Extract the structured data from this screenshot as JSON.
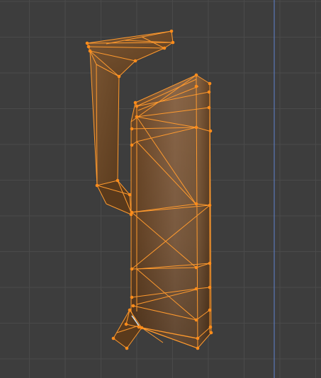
{
  "viewport": {
    "background_color": "#3d3d3d",
    "grid_color": "#4a4a4a",
    "z_axis_color": "#5a78b8",
    "mode": "edit-mode",
    "selection_state": "all-selected"
  },
  "mesh": {
    "object": "selected-mesh",
    "face_color_dark": "#5a3a1a",
    "face_color_light": "#8a6648",
    "edge_color": "#ff9a2e",
    "vertex_color": "#ff8c1a",
    "active_edge_color": "#c8e8ff"
  }
}
